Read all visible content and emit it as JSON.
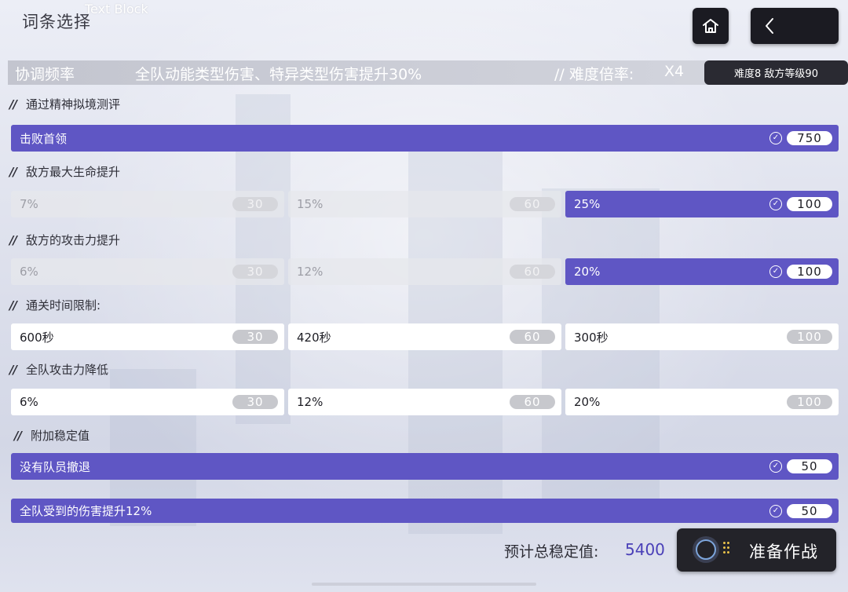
{
  "header": {
    "tiny_label": "Text  Block",
    "title": "词条选择",
    "home_icon": "home-icon",
    "back_icon": "chevron-left-icon"
  },
  "info_bar": {
    "name": "协调频率",
    "effect": "全队动能类型伤害、特异类型伤害提升30%",
    "multiplier_label": "// 难度倍率:",
    "multiplier_value": "X4",
    "difficulty": "难度8  敌方等级90"
  },
  "sections": [
    {
      "title": "通过精神拟境测评",
      "options": [
        {
          "label": "击败首领",
          "value": "750",
          "state": "selected"
        }
      ]
    },
    {
      "title": "敌方最大生命提升",
      "options": [
        {
          "label": "7%",
          "value": "30",
          "state": "disabled"
        },
        {
          "label": "15%",
          "value": "60",
          "state": "disabled"
        },
        {
          "label": "25%",
          "value": "100",
          "state": "selected"
        }
      ]
    },
    {
      "title": "敌方的攻击力提升",
      "options": [
        {
          "label": "6%",
          "value": "30",
          "state": "disabled"
        },
        {
          "label": "12%",
          "value": "60",
          "state": "disabled"
        },
        {
          "label": "20%",
          "value": "100",
          "state": "selected"
        }
      ]
    },
    {
      "title": "通关时间限制:",
      "options": [
        {
          "label": "600秒",
          "value": "30",
          "state": "available"
        },
        {
          "label": "420秒",
          "value": "60",
          "state": "available"
        },
        {
          "label": "300秒",
          "value": "100",
          "state": "available"
        }
      ]
    },
    {
      "title": "全队攻击力降低",
      "options": [
        {
          "label": "6%",
          "value": "30",
          "state": "available"
        },
        {
          "label": "12%",
          "value": "60",
          "state": "available"
        },
        {
          "label": "20%",
          "value": "100",
          "state": "available"
        }
      ]
    },
    {
      "title": "附加稳定值",
      "options": [
        {
          "label": "没有队员撤退",
          "value": "50",
          "state": "selected"
        },
        {
          "label": "全队受到的伤害提升12%",
          "value": "50",
          "state": "selected"
        }
      ]
    }
  ],
  "footer": {
    "total_label": "预计总稳定值:",
    "total_value": "5400",
    "start_label": "准备作战"
  },
  "colors": {
    "selected": "#5f56c4",
    "dark_button": "#232329",
    "total_value": "#4a40b8"
  }
}
